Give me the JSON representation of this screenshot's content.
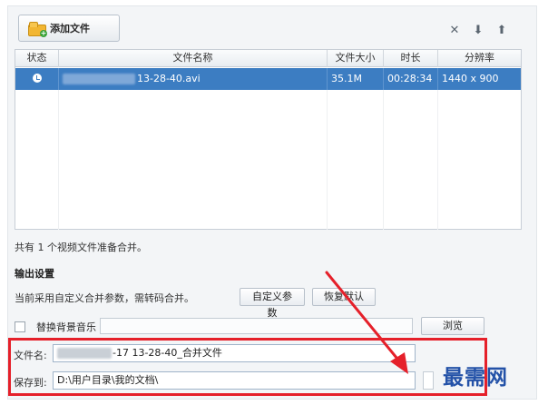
{
  "toolbar": {
    "add_file_label": "添加文件",
    "icons": [
      "clear-icon",
      "move-down-icon",
      "move-up-icon"
    ]
  },
  "table": {
    "headers": [
      "状态",
      "文件名称",
      "文件大小",
      "时长",
      "分辨率"
    ],
    "rows": [
      {
        "status_icon": "play-circle-icon",
        "name_suffix": "13-28-40.avi",
        "size": "35.1M",
        "duration": "00:28:34",
        "resolution": "1440 x 900"
      }
    ]
  },
  "summary_text": "共有 1 个视频文件准备合并。",
  "output": {
    "section_title": "输出设置",
    "custom_note": "当前采用自定义合并参数，需转码合并。",
    "custom_params_label": "自定义参数",
    "restore_default_label": "恢复默认",
    "replace_music_label": "替换背景音乐",
    "browse_label": "浏览",
    "filename_label": "文件名:",
    "filename_value": "-17 13-28-40_合并文件",
    "save_to_label": "保存到:",
    "save_to_value": "D:\\用户目录\\我的文档\\"
  },
  "watermark": "最需网",
  "colors": {
    "selected_row": "#3c7dc2",
    "highlight_box": "#e5202a",
    "watermark": "#2452a8"
  }
}
